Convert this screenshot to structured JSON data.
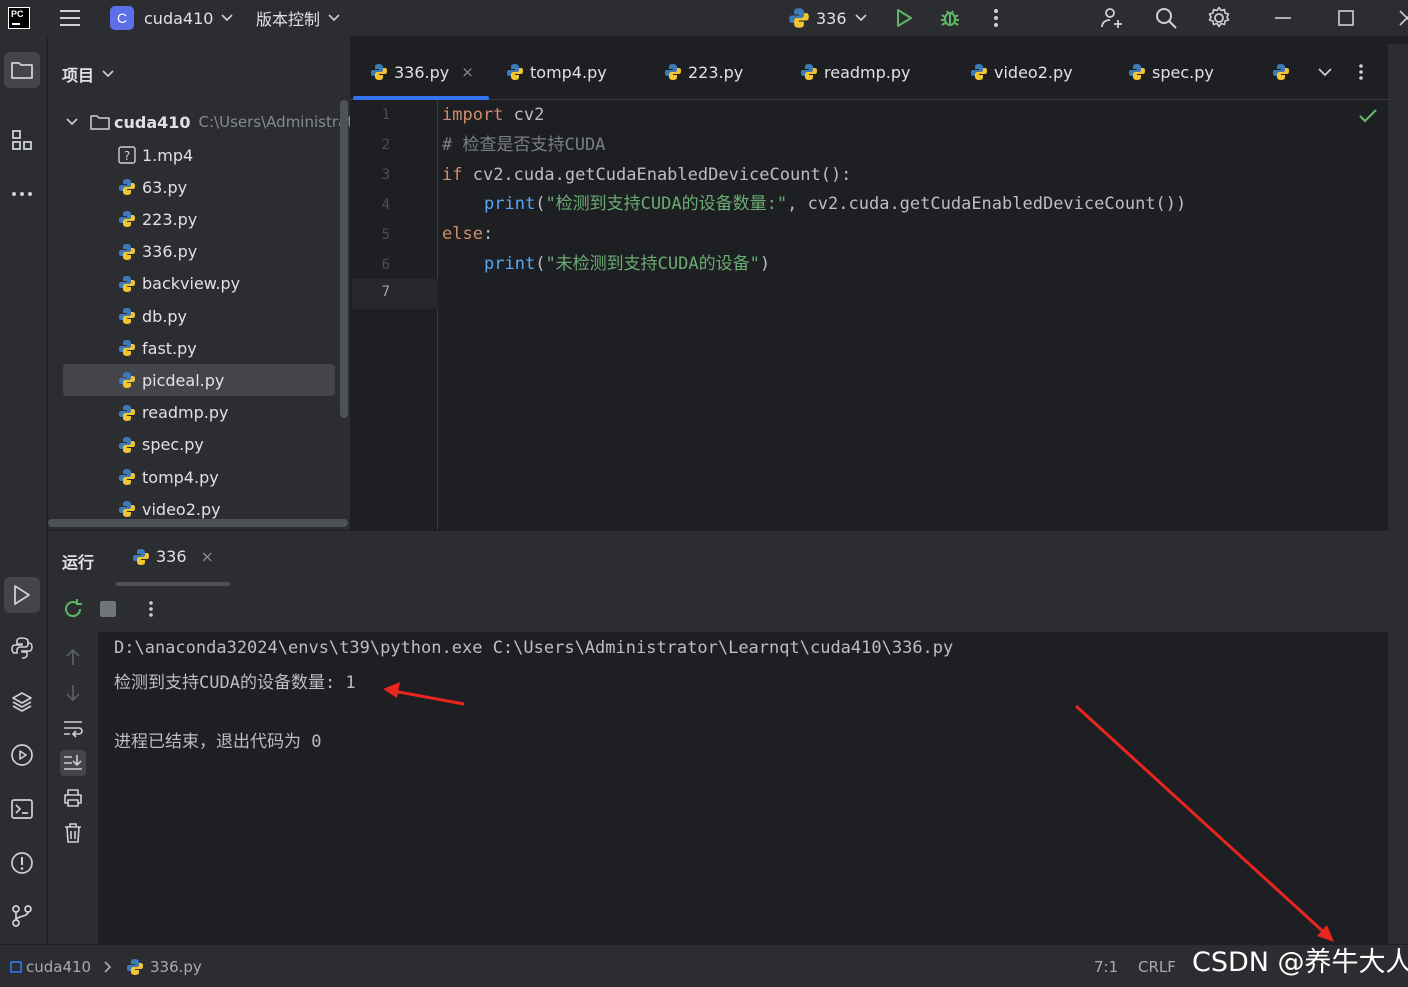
{
  "titlebar": {
    "project_badge": "C",
    "project_name": "cuda410",
    "vcs_label": "版本控制",
    "run_config": "336"
  },
  "project_panel": {
    "title": "项目",
    "root_name": "cuda410",
    "root_path": "C:\\Users\\Administrat",
    "files": [
      "1.mp4",
      "63.py",
      "223.py",
      "336.py",
      "backview.py",
      "db.py",
      "fast.py",
      "picdeal.py",
      "readmp.py",
      "spec.py",
      "tomp4.py",
      "video2.py"
    ],
    "selected_file": "picdeal.py"
  },
  "editor": {
    "tabs": [
      "336.py",
      "tomp4.py",
      "223.py",
      "readmp.py",
      "video2.py",
      "spec.py"
    ],
    "active_tab": "336.py",
    "tab_close": "×",
    "line_numbers": [
      "1",
      "2",
      "3",
      "4",
      "5",
      "6",
      "7"
    ],
    "code": {
      "l1_kw": "import",
      "l1_rest": " cv2",
      "l2": "# 检查是否支持CUDA",
      "l3_kw": "if",
      "l3_rest": " cv2.cuda.getCudaEnabledDeviceCount():",
      "l4_fn": "print",
      "l4_open": "(",
      "l4_str": "\"检测到支持CUDA的设备数量:\"",
      "l4_rest": ", cv2.cuda.getCudaEnabledDeviceCount())",
      "l5_kw": "else",
      "l5_rest": ":",
      "l6_fn": "print",
      "l6_open": "(",
      "l6_str": "\"未检测到支持CUDA的设备\"",
      "l6_close": ")"
    }
  },
  "run_panel": {
    "title": "运行",
    "tab_label": "336",
    "tab_close": "×",
    "output": [
      "D:\\anaconda32024\\envs\\t39\\python.exe C:\\Users\\Administrator\\Learnqt\\cuda410\\336.py",
      "检测到支持CUDA的设备数量: 1",
      "",
      "进程已结束，退出代码为 0"
    ]
  },
  "statusbar": {
    "project": "cuda410",
    "file": "336.py",
    "position": "7:1",
    "line_ending": "CRLF"
  },
  "watermark": "CSDN @养牛大人",
  "colors": {
    "accent": "#3574f0",
    "annotation_arrow": "#e8251f",
    "keyword": "#cf8e6d",
    "string": "#6aab73",
    "function": "#56a8f5",
    "comment": "#7a7e85"
  }
}
